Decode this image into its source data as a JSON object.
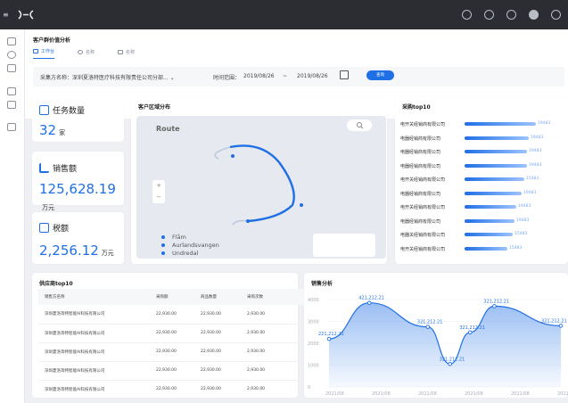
{
  "app": {
    "menu_glyph": "≡",
    "topbar_icons": [
      "target-icon",
      "clock-icon",
      "settings-icon",
      "user-icon",
      "info-icon"
    ],
    "accent": "#1f6fe5"
  },
  "page": {
    "title": "客户群价值分析",
    "tabs": [
      {
        "label": "工作台",
        "active": true
      },
      {
        "label": "名称",
        "active": false
      },
      {
        "label": "名称",
        "active": false
      }
    ]
  },
  "filter": {
    "purchaser_label": "采集方名称：深圳夏洛特医疗科技有限责任公司分部... ⌄",
    "time_label": "时间范围：",
    "date_from": "2019/08/26",
    "date_sep": "~",
    "date_to": "2019/08/26",
    "query_button": "查询"
  },
  "kpis": [
    {
      "title": "任务数量",
      "value": "32",
      "unit": "家"
    },
    {
      "title": "销售额",
      "value": "125,628.19",
      "unit": "万元"
    },
    {
      "title": "税额",
      "value": "2,256.12",
      "unit": "万元"
    }
  ],
  "map_card": {
    "title": "客户区域分布",
    "route_label": "Route",
    "legend": [
      "Flåm",
      "Aurlandsvangen",
      "Undredal"
    ],
    "zoom_in": "+",
    "zoom_out": "−"
  },
  "top10_card": {
    "title": "采购top10",
    "chart_data": {
      "type": "bar",
      "orientation": "horizontal",
      "categories": [
        "电开关经销商有限公司",
        "电器经销商有限公司",
        "电器经销商有限公司",
        "电器经销商有限公司",
        "电开关经销商有限公司",
        "电器经销商有限公司",
        "电开关经销商有限公司",
        "电器经销商有限公司",
        "电器关经销商有限公司",
        "电开关经销商有限公司"
      ],
      "values": [
        19483,
        19483,
        19483,
        19483,
        19483,
        19483,
        19483,
        19483,
        19483,
        19483
      ],
      "value_labels": [
        "19483",
        "19483",
        "19483",
        "19483",
        "15483",
        "19483",
        "19483",
        "19483",
        "15483",
        "15483"
      ],
      "bar_fraction": [
        1.0,
        0.9,
        0.88,
        0.88,
        0.84,
        0.8,
        0.72,
        0.7,
        0.68,
        0.6
      ]
    }
  },
  "supplier_table": {
    "title": "供应商top10",
    "columns": [
      "销售方名称",
      "采购额",
      "商品数量",
      "采购次数"
    ],
    "rows": [
      [
        "深圳夏洛等特智能AI科技有限公司",
        "22,930.00",
        "22,930.00",
        "2,930.00"
      ],
      [
        "深圳夏洛等特智能AI科技有限公司",
        "22,930.00",
        "22,930.00",
        "2,930.00"
      ],
      [
        "深圳夏洛等特智能AI科技有限公司",
        "22,930.00",
        "22,930.00",
        "2,930.00"
      ],
      [
        "深圳夏洛等特智能AI科技有限公司",
        "22,930.00",
        "22,930.00",
        "2,930.00"
      ],
      [
        "深圳夏洛等特智能AI科技有限公司",
        "22,930.00",
        "22,930.00",
        "2,930.00"
      ]
    ]
  },
  "sales_card": {
    "title": "销售分析",
    "chart_data": {
      "type": "area",
      "x": [
        "2021/08",
        "2021/08",
        "2021/08",
        "2021/08",
        "2021/08",
        "2021/08"
      ],
      "ylim": [
        0,
        4000
      ],
      "yticks": [
        "0",
        "1000",
        "2000",
        "3000",
        "4000"
      ],
      "points": [
        {
          "x": 0,
          "y": 2200,
          "label": "221,212.21"
        },
        {
          "x": 1,
          "y": 3850,
          "label": "421,212.21"
        },
        {
          "x": 2.45,
          "y": 2750,
          "label": "321,212.21"
        },
        {
          "x": 3,
          "y": 1050,
          "label": "321,212.21"
        },
        {
          "x": 3.5,
          "y": 2500,
          "label": "321,212.21"
        },
        {
          "x": 4.1,
          "y": 3700,
          "label": "321,212.21"
        },
        {
          "x": 5.75,
          "y": 2800,
          "label": "321,212.21"
        }
      ]
    }
  }
}
